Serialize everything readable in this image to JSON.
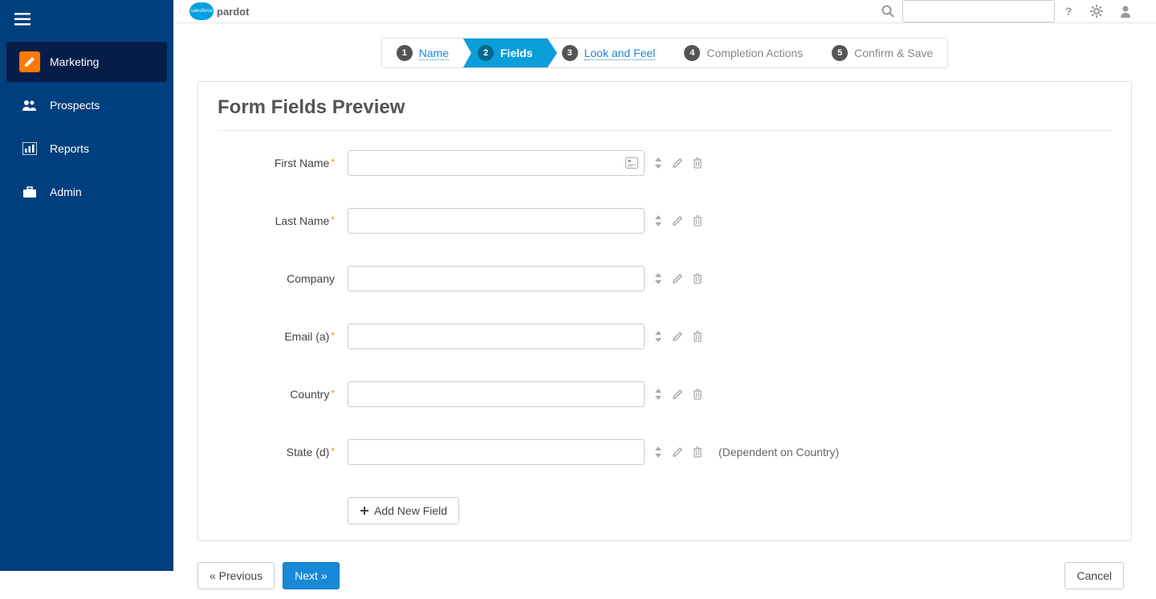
{
  "logo": {
    "brand": "salesforce",
    "product": "pardot"
  },
  "sidebar": {
    "items": [
      {
        "label": "Marketing",
        "icon": "pencil-icon",
        "active": true
      },
      {
        "label": "Prospects",
        "icon": "users-icon",
        "active": false
      },
      {
        "label": "Reports",
        "icon": "chart-icon",
        "active": false
      },
      {
        "label": "Admin",
        "icon": "briefcase-icon",
        "active": false
      }
    ]
  },
  "wizard": {
    "steps": [
      {
        "num": "1",
        "label": "Name"
      },
      {
        "num": "2",
        "label": "Fields"
      },
      {
        "num": "3",
        "label": "Look and Feel"
      },
      {
        "num": "4",
        "label": "Completion Actions"
      },
      {
        "num": "5",
        "label": "Confirm & Save"
      }
    ],
    "active_index": 1
  },
  "panel": {
    "title": "Form Fields Preview",
    "fields": [
      {
        "label": "First Name",
        "required": true,
        "has_autofill": true,
        "note": ""
      },
      {
        "label": "Last Name",
        "required": true,
        "has_autofill": false,
        "note": ""
      },
      {
        "label": "Company",
        "required": false,
        "has_autofill": false,
        "note": ""
      },
      {
        "label": "Email (a)",
        "required": true,
        "has_autofill": false,
        "note": ""
      },
      {
        "label": "Country",
        "required": true,
        "has_autofill": false,
        "note": ""
      },
      {
        "label": "State (d)",
        "required": true,
        "has_autofill": false,
        "note": "(Dependent on Country)"
      }
    ],
    "add_button": "Add New Field"
  },
  "footer": {
    "previous": "« Previous",
    "next": "Next »",
    "cancel": "Cancel"
  }
}
